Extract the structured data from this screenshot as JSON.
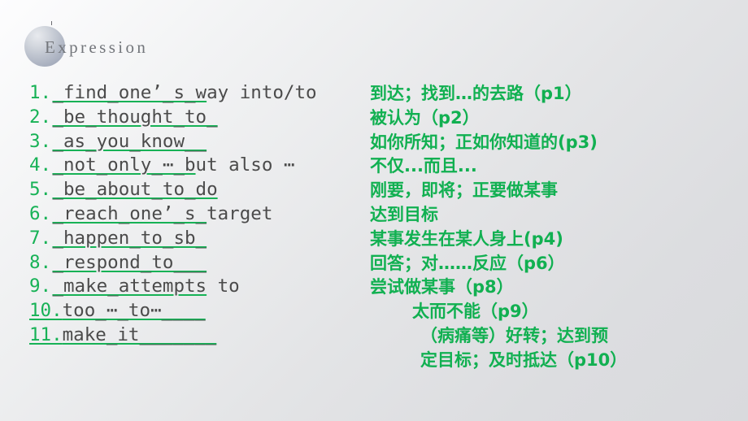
{
  "slide": {
    "title": "Expression",
    "background_top": "#fdfdfe",
    "background_bottom": "#d9dadd",
    "accent_green": "#17b256",
    "body_gray": "#4b4b4b",
    "title_gray": "#73767b"
  },
  "expressions": [
    {
      "number": "1.",
      "underlined": "_find_one’_s_w",
      "plain": "ay into/to",
      "meaning": "到达；找到…的去路（p1）"
    },
    {
      "number": "2.",
      "underlined": "_be_thought_to_",
      "plain": "",
      "meaning": "被认为（p2）"
    },
    {
      "number": "3.",
      "underlined": "_as_you_know__",
      "plain": "",
      "meaning": "如你所知；正如你知道的(p3)"
    },
    {
      "number": "4.",
      "underlined": "_not_only_⋯_b",
      "plain": "ut also ⋯",
      "meaning": "不仅...而且..."
    },
    {
      "number": "5.",
      "underlined": "_be_about_to_do",
      "plain": "",
      "meaning": "刚要，即将；正要做某事"
    },
    {
      "number": "6.",
      "underlined": "_reach_one’_s_",
      "plain": "target",
      "meaning": "达到目标"
    },
    {
      "number": "7.",
      "underlined": "_happen_to_sb_",
      "plain": "",
      "meaning": "某事发生在某人身上(p4)"
    },
    {
      "number": "8.",
      "underlined": "_respond_to___",
      "plain": "",
      "meaning": "回答；对……反应（p6）"
    },
    {
      "number": "9.",
      "underlined": "_make_attempts",
      "plain": " to",
      "meaning": "尝试做某事（p8）"
    },
    {
      "number": "10.",
      "underlined": "too_⋯_to⋯____",
      "plain": "",
      "meaning": "太而不能（p9）",
      "number_underlined": true,
      "meaning_indent": 1
    },
    {
      "number": "11.",
      "underlined": "make_it_______",
      "plain": "",
      "meaning": "（病痛等）好转；达到预",
      "number_underlined": true,
      "meaning_indent": 2
    }
  ],
  "meaning_overflow": {
    "text": "定目标；及时抵达（p10）",
    "indent": 2
  }
}
